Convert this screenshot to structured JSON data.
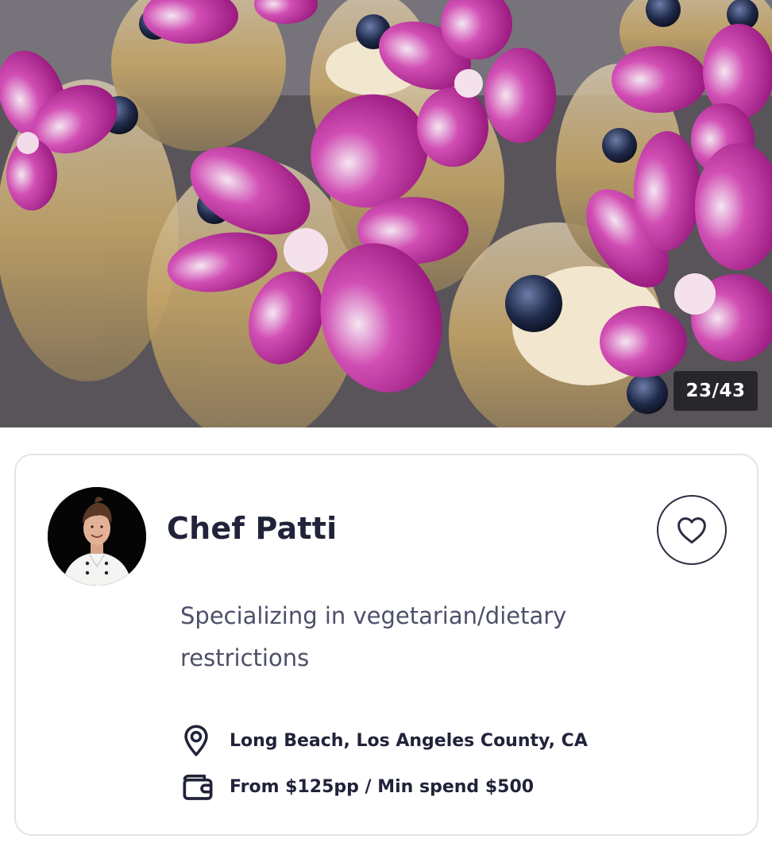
{
  "gallery": {
    "counter": "23/43",
    "image_alt": "Dessert jars topped with blueberries and purple orchids"
  },
  "chef": {
    "name": "Chef Patti",
    "tagline": "Specializing in vegetarian/dietary restrictions",
    "location": "Long Beach, Los Angeles County, CA",
    "pricing": "From $125pp / Min spend $500",
    "avatar_icon": "chef-portrait"
  },
  "icons": {
    "favorite": "heart-icon",
    "location": "location-pin-icon",
    "pricing": "wallet-icon"
  },
  "colors": {
    "text_primary": "#21233a",
    "text_secondary": "#4d5068",
    "card_border": "#e4e4e8",
    "orchid": "#b0128f"
  }
}
